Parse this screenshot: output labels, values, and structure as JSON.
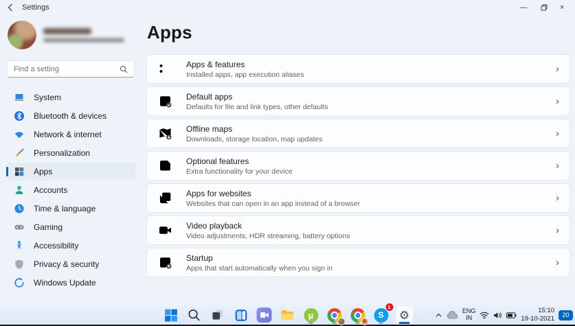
{
  "titlebar": {
    "title": "Settings",
    "minimize": "—",
    "close": "×"
  },
  "icons": {
    "back": "chevron-left",
    "restore": "overlapping-squares",
    "search": "magnifier",
    "chevron_right": "›",
    "settings_gear": "⚙"
  },
  "profile": {
    "name_redacted": true,
    "email_redacted": true
  },
  "sidebar": {
    "search_placeholder": "Find a setting",
    "items": [
      {
        "label": "System",
        "icon": "laptop-icon",
        "selected": false
      },
      {
        "label": "Bluetooth & devices",
        "icon": "bluetooth-icon",
        "selected": false
      },
      {
        "label": "Network & internet",
        "icon": "wifi-globe-icon",
        "selected": false
      },
      {
        "label": "Personalization",
        "icon": "brush-icon",
        "selected": false
      },
      {
        "label": "Apps",
        "icon": "apps-grid-icon",
        "selected": true
      },
      {
        "label": "Accounts",
        "icon": "person-icon",
        "selected": false
      },
      {
        "label": "Time & language",
        "icon": "clock-icon",
        "selected": false
      },
      {
        "label": "Gaming",
        "icon": "gamepad-icon",
        "selected": false
      },
      {
        "label": "Accessibility",
        "icon": "accessibility-icon",
        "selected": false
      },
      {
        "label": "Privacy & security",
        "icon": "shield-icon",
        "selected": false
      },
      {
        "label": "Windows Update",
        "icon": "update-arrows-icon",
        "selected": false
      }
    ]
  },
  "main": {
    "title": "Apps",
    "cards": [
      {
        "title": "Apps & features",
        "subtitle": "Installed apps, app execution aliases",
        "icon": "list-icon"
      },
      {
        "title": "Default apps",
        "subtitle": "Defaults for file and link types, other defaults",
        "icon": "app-check-icon"
      },
      {
        "title": "Offline maps",
        "subtitle": "Downloads, storage location, map updates",
        "icon": "map-download-icon"
      },
      {
        "title": "Optional features",
        "subtitle": "Extra functionality for your device",
        "icon": "grid-plus-icon"
      },
      {
        "title": "Apps for websites",
        "subtitle": "Websites that can open in an app instead of a browser",
        "icon": "app-link-icon"
      },
      {
        "title": "Video playback",
        "subtitle": "Video adjustments, HDR streaming, battery options",
        "icon": "video-camera-icon"
      },
      {
        "title": "Startup",
        "subtitle": "Apps that start automatically when you sign in",
        "icon": "startup-icon"
      }
    ]
  },
  "taskbar": {
    "apps": [
      "start",
      "search",
      "task-view",
      "widgets",
      "chat",
      "file-explorer",
      "utorrent",
      "chrome-profile-1",
      "chrome-profile-2",
      "skype",
      "settings"
    ],
    "utorrent_glyph": "µ",
    "skype_glyph": "S",
    "chrome2_badge_letter": "A",
    "skype_badge": "1",
    "tray": {
      "language_line1": "ENG",
      "language_line2": "IN",
      "time": "15:10",
      "date": "19-10-2021",
      "notification_count": "20"
    }
  },
  "colors": {
    "accent": "#0067c0",
    "page_bg": "#eef3fa",
    "card_bg": "#fcfdfe",
    "taskbar_bg": "#e3edf9"
  }
}
